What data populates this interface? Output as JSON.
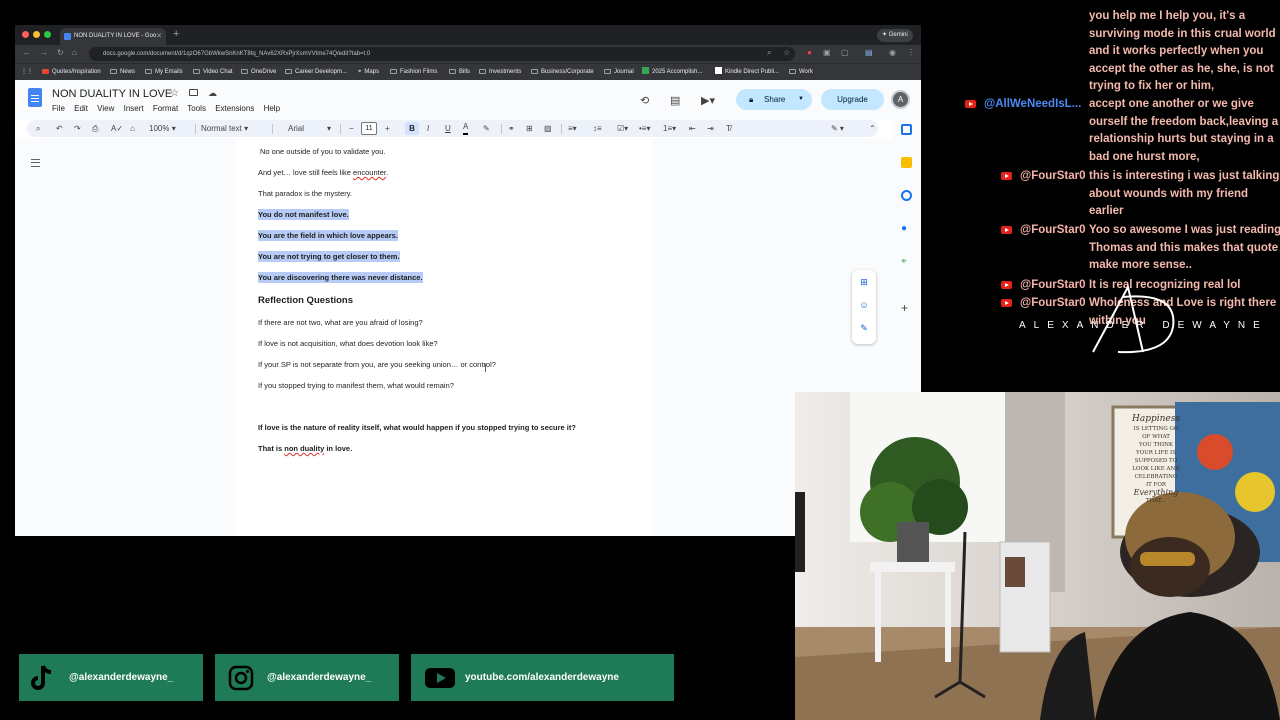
{
  "browser": {
    "tab_title": "NON DUALITY IN LOVE - Goo",
    "gemini_label": "Gemini",
    "url": "docs.google.com/document/d/1qzO67GbWkwSnKnKT8tq_NAv62XRxPjrXsmVVtme74Q/edit?tab=t.0",
    "bookmarks": [
      "Quotes/Inspiration",
      "News",
      "My Emails",
      "Video Chat",
      "OneDrive",
      "Career Developm...",
      "Maps",
      "Fashion Films",
      "Bills",
      "Investments",
      "Business/Corporate",
      "Journal",
      "2025 Accomplish...",
      "Kindle Direct Publi...",
      "Work"
    ]
  },
  "docs": {
    "title": "NON DUALITY IN LOVE",
    "menu": [
      "File",
      "Edit",
      "View",
      "Insert",
      "Format",
      "Tools",
      "Extensions",
      "Help"
    ],
    "share_label": "Share",
    "upgrade_label": "Upgrade",
    "avatar_letter": "A",
    "toolbar": {
      "zoom": "100%",
      "style": "Normal text",
      "font": "Arial",
      "font_size": "11"
    }
  },
  "document": {
    "line1": "No one outside of you to validate you.",
    "line2_a": "And yet… love still feels like ",
    "line2_b": "encounter",
    "line2_c": ".",
    "line3": "That paradox is the mystery.",
    "hl1": "You do not manifest love.",
    "hl2": "You are the field in which love appears.",
    "hl3": "You are not trying to get closer to them.",
    "hl4": "You are discovering there was never distance.",
    "heading": "Reflection Questions",
    "q1": "If there are not two, what are you afraid of losing?",
    "q2": "If love is not acquisition, what does devotion look like?",
    "q3": "If your SP is not separate from you, are you seeking union… or control?",
    "q4": "If you stopped trying to manifest them, what would remain?",
    "closing": "If love is the nature of reality itself, what would happen if you stopped trying to secure it?",
    "final_a": "That is ",
    "final_b": "non duality",
    "final_c": " in love."
  },
  "chat": {
    "messages": [
      {
        "author": "",
        "lines": [
          "you help me I help you, it's a",
          "surviving mode in this crual world",
          "and it works perfectly when you",
          "accept the other as he, she, is not",
          "trying to fix her or him,"
        ]
      },
      {
        "author": "@AllWeNeedIsL...",
        "lines": [
          "accept one another or we give",
          "ourself the freedom back,leaving a",
          "relationship hurts but staying in a",
          "bad one hurst more,"
        ]
      },
      {
        "author": "@FourStar0",
        "lines": [
          "this is interesting i was just talking",
          "about wounds with my friend",
          "earlier"
        ]
      },
      {
        "author": "@FourStar0",
        "lines": [
          "Yoo so awesome I was just reading",
          "Thomas and this makes that quote",
          "make more sense.."
        ]
      },
      {
        "author": "@FourStar0",
        "lines": [
          "It is real recognizing real lol"
        ]
      },
      {
        "author": "@FourStar0",
        "lines": [
          "Wholeness and Love is right there",
          "within you"
        ]
      }
    ],
    "brand": "ALEXANDER DEWAYNE"
  },
  "webcam": {
    "poster_lines": [
      "Happiness",
      "IS LETTING GO",
      "OF WHAT",
      "YOU THINK",
      "YOUR LIFE IS",
      "SUPPOSED TO",
      "LOOK LIKE AND",
      "CELEBRATING",
      "IT FOR",
      "Everything",
      "THAT..."
    ]
  },
  "socials": {
    "tiktok": "@alexanderdewayne_",
    "instagram": "@alexanderdewayne_",
    "youtube": "youtube.com/alexanderdewayne"
  },
  "colors": {
    "highlight": "#b6cbf5",
    "chat_text": "#f4b9ac",
    "chat_author_blue": "#4a8af4",
    "banner_green": "#1e7a57",
    "share_blue": "#c2e7ff"
  }
}
